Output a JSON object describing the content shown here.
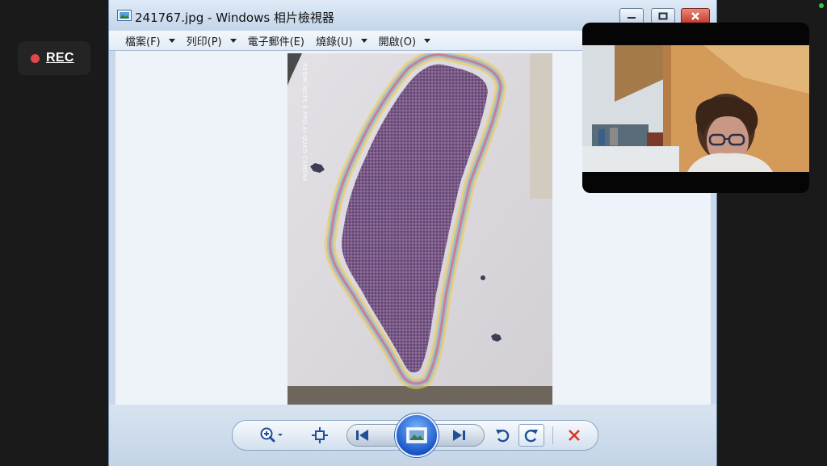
{
  "recording": {
    "label": "REC"
  },
  "window": {
    "title": "241767.jpg - Windows 相片檢視器",
    "controls": {
      "minimize": "minimize",
      "maximize": "maximize",
      "close": "close"
    }
  },
  "menu": [
    {
      "label": "檔案(F)"
    },
    {
      "label": "列印(P)"
    },
    {
      "label": "電子郵件(E)"
    },
    {
      "label": "燒錄(U)"
    },
    {
      "label": "開啟(O)"
    }
  ],
  "photo": {
    "watermark": "REDMI NOTE 8 PRO\nAI QUAD CAMERA",
    "subject": "hand-drawn map of Taiwan with rainbow outline"
  },
  "toolbar": {
    "icons": [
      "zoom-icon",
      "actual-size-icon",
      "previous-icon",
      "slideshow-icon",
      "next-icon",
      "rotate-left-icon",
      "rotate-right-icon",
      "delete-icon"
    ]
  },
  "colors": {
    "rec_dot": "#e0474c",
    "status_dot": "#2ecc40",
    "close_button": "#c23b28",
    "delete_icon": "#d23a2a",
    "slideshow_button": "#1a58c9"
  }
}
